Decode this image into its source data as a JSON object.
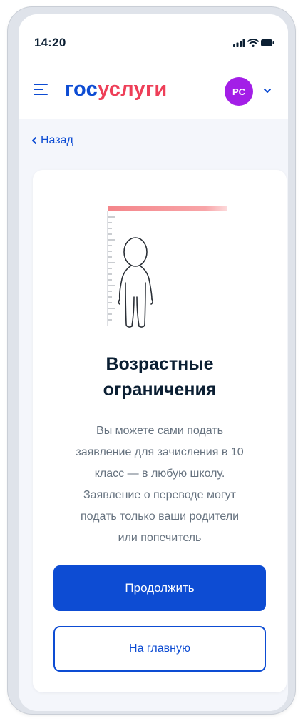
{
  "status_bar": {
    "time": "14:20",
    "icons": [
      "signal-icon",
      "wifi-icon",
      "battery-icon"
    ]
  },
  "header": {
    "logo_part1": "гос",
    "logo_part2": "услуги",
    "avatar_initials": "PC",
    "menu_icon": "hamburger-menu-icon",
    "chevron_icon": "chevron-down-icon"
  },
  "nav": {
    "back_icon": "chevron-left-icon",
    "back_label": "Назад"
  },
  "card": {
    "illustration": "child-height-measure-illustration",
    "title_lines": [
      "Возрастные",
      "ограничения"
    ],
    "description_lines": [
      "Вы можете сами подать",
      "заявление для зачисления в 10",
      "класс — в любую школу.",
      "Заявление о переводе могут",
      "подать только ваши родители",
      "или попечитель"
    ],
    "primary_button": "Продолжить",
    "secondary_button": "На главную"
  },
  "colors": {
    "brand_blue": "#0d4cd3",
    "brand_red": "#ee3f58",
    "avatar": "#a31ee7",
    "background": "#f4f6fb",
    "text_primary": "#0b1f33",
    "text_secondary": "#66727f"
  }
}
